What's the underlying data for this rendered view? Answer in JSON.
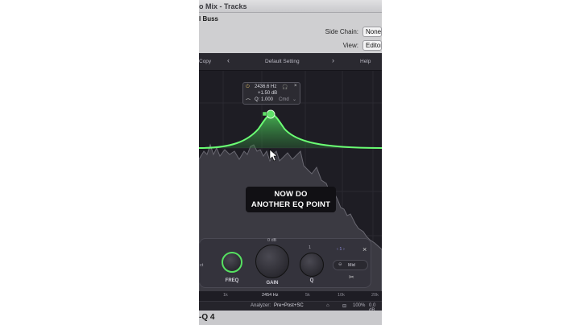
{
  "window": {
    "title": "o Mix - Tracks"
  },
  "header": {
    "track_name": "l Buss",
    "side_chain_label": "Side Chain:",
    "side_chain_value": "None",
    "view_label": "View:",
    "view_value": "Editor"
  },
  "toolbar": {
    "copy_label": "Copy",
    "prev_label": "‹",
    "preset_name": "Default Setting",
    "next_label": "›",
    "help_label": "Help"
  },
  "band_tooltip": {
    "frequency": "2436.6 Hz",
    "gain": "+1.50 dB",
    "q": "Q: 1.000",
    "mode": "Cmd",
    "power_icon": "power-icon",
    "headphones_icon": "headphones-icon",
    "close_icon": "close-icon",
    "shape_icon": "bell-shape-icon"
  },
  "caption": {
    "line1": "NOW DO",
    "line2": "ANOTHER EQ POINT"
  },
  "band_panel": {
    "gain_scale_top": "0 dB",
    "q_scale_top": "1",
    "freq_label": "FREQ",
    "gain_label": "GAIN",
    "q_label": "Q",
    "left_fragment": "ct",
    "stereo_mode": "Mid",
    "band_nav": "‹ 1 ›",
    "close_icon": "close-icon",
    "scissors_icon": "scissors-icon"
  },
  "freq_ruler": {
    "labels": [
      "1k",
      "2454 Hz",
      "5k",
      "10k",
      "20k"
    ]
  },
  "bottom_bar": {
    "analyzer_label": "Analyzer:",
    "analyzer_value": "Pre+Post+SC",
    "zoom": "100%",
    "output_gain": "0.0 dB"
  },
  "footer": {
    "product_fragment": "-Q 4"
  },
  "colors": {
    "accent_green": "#5fe068",
    "panel_bg": "#1c1b21"
  }
}
